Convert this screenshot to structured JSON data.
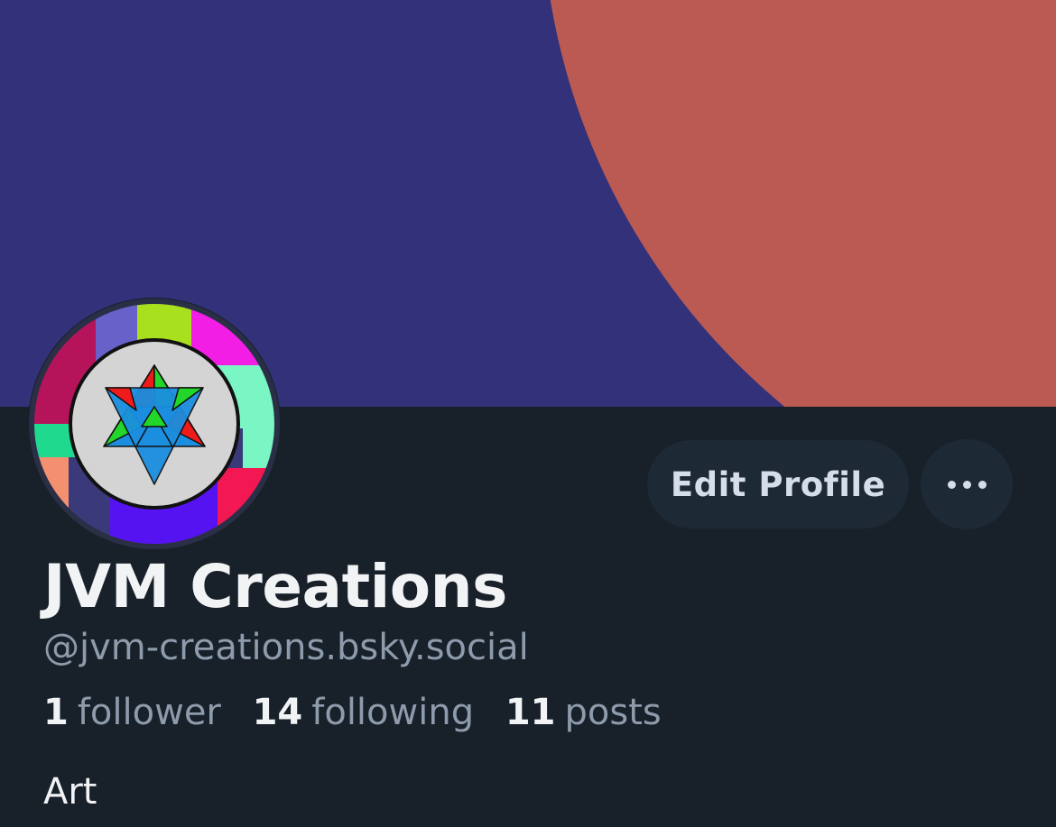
{
  "banner": {
    "background_color": "#33317a",
    "circle_color": "#bb5a52"
  },
  "avatar": {
    "ring_colors": [
      "#b5145a",
      "#6761c9",
      "#a8e01e",
      "#f31ee6",
      "#7af5c4",
      "#f31752",
      "#5613f2",
      "#3a3a7a",
      "#f39070",
      "#1fd98f"
    ],
    "center_color": "#d4d4d4",
    "emblem": "star-tetrahedron-icon"
  },
  "actions": {
    "edit_profile_label": "Edit Profile",
    "more_icon": "ellipsis-icon"
  },
  "profile": {
    "display_name": "JVM Creations",
    "handle": "@jvm-creations.bsky.social",
    "bio": "Art"
  },
  "stats": {
    "followers_count": "1",
    "followers_label": "follower",
    "following_count": "14",
    "following_label": "following",
    "posts_count": "11",
    "posts_label": "posts"
  },
  "colors": {
    "page_background": "#18202a",
    "button_background": "#1e2936",
    "primary_text": "#f1f3f5",
    "secondary_text": "#8d9bab"
  }
}
